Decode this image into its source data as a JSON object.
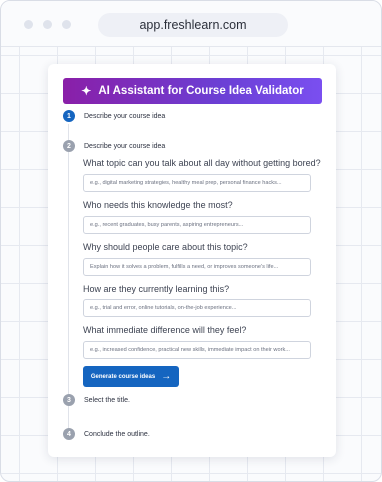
{
  "browser": {
    "url": "app.freshlearn.com"
  },
  "card": {
    "title": "AI Assistant for Course Idea Validator",
    "steps": [
      {
        "number": "1",
        "label": "Describe your course idea"
      },
      {
        "number": "2",
        "label": "Describe your course idea"
      },
      {
        "number": "3",
        "label": "Select the title."
      },
      {
        "number": "4",
        "label": "Conclude the outline."
      }
    ],
    "questions": [
      {
        "label": "What topic can you talk about all day without getting bored?",
        "placeholder": "e.g., digital marketing strategies, healthy meal prep, personal finance hacks..."
      },
      {
        "label": "Who needs this knowledge the most?",
        "placeholder": "e.g., recent graduates, busy parents, aspiring entrepreneurs..."
      },
      {
        "label": "Why should people care about this topic?",
        "placeholder": "Explain how it solves a problem, fulfills a need, or improves someone's life..."
      },
      {
        "label": "How are they currently learning this?",
        "placeholder": "e.g., trial and error, online tutorials, on-the-job experience..."
      },
      {
        "label": "What immediate difference will they feel?",
        "placeholder": "e.g., increased confidence, practical new skills, immediate impact on their work..."
      }
    ],
    "generate_button": "Generate course ideas"
  },
  "colors": {
    "accent": "#1565c0",
    "header_gradient_start": "#8a1fa8",
    "header_gradient_end": "#7a4ff0"
  }
}
